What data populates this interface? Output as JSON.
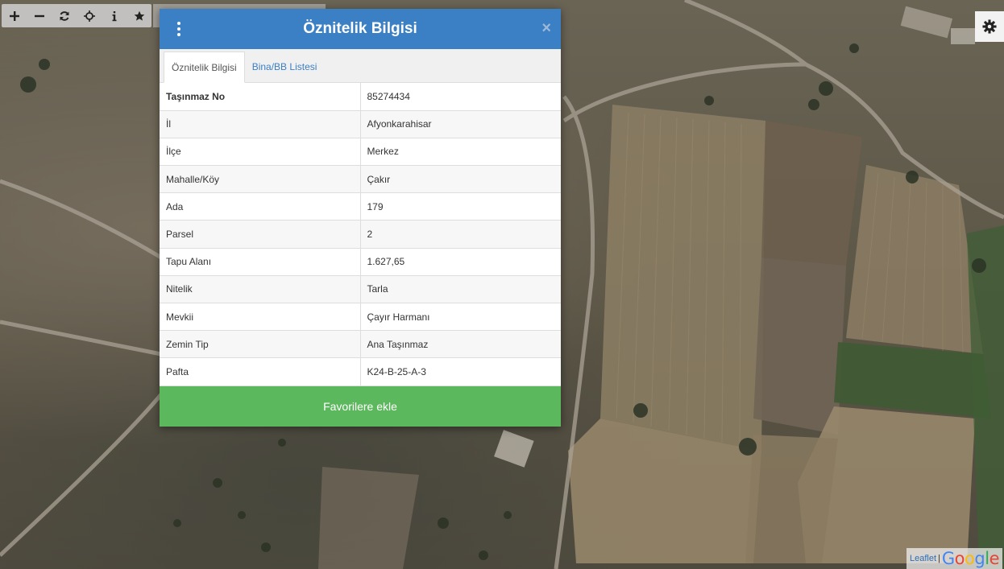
{
  "toolbar": {
    "tools": [
      {
        "name": "zoom-in-button",
        "icon": "plus-icon"
      },
      {
        "name": "zoom-out-button",
        "icon": "minus-icon"
      },
      {
        "name": "refresh-button",
        "icon": "refresh-icon"
      },
      {
        "name": "locate-button",
        "icon": "crosshair-icon"
      },
      {
        "name": "info-button",
        "icon": "info-icon"
      },
      {
        "name": "favorites-button",
        "icon": "star-icon"
      }
    ]
  },
  "settings": {
    "icon": "gear-icon"
  },
  "modal": {
    "title": "Öznitelik Bilgisi",
    "close_label": "×",
    "tabs": [
      {
        "label": "Öznitelik Bilgisi",
        "active": true
      },
      {
        "label": "Bina/BB Listesi",
        "active": false
      }
    ],
    "rows": [
      {
        "key": "Taşınmaz No",
        "value": "85274434"
      },
      {
        "key": "İl",
        "value": "Afyonkarahisar"
      },
      {
        "key": "İlçe",
        "value": "Merkez"
      },
      {
        "key": "Mahalle/Köy",
        "value": "Çakır"
      },
      {
        "key": "Ada",
        "value": "179"
      },
      {
        "key": "Parsel",
        "value": "2"
      },
      {
        "key": "Tapu Alanı",
        "value": "1.627,65"
      },
      {
        "key": "Nitelik",
        "value": "Tarla"
      },
      {
        "key": "Mevkii",
        "value": "Çayır Harmanı"
      },
      {
        "key": "Zemin Tip",
        "value": "Ana Taşınmaz"
      },
      {
        "key": "Pafta",
        "value": "K24-B-25-A-3"
      }
    ],
    "favorite_button": "Favorilere ekle"
  },
  "attribution": {
    "leaflet": "Leaflet",
    "separator": "|",
    "google_letters": [
      "G",
      "o",
      "o",
      "g",
      "l",
      "e"
    ]
  },
  "colors": {
    "header_blue": "#3b7fc4",
    "favorite_green": "#5cb85c",
    "link_blue": "#3b7fc4"
  }
}
